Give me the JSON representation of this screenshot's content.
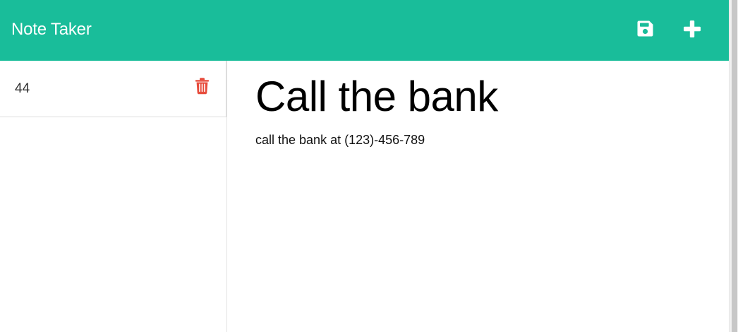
{
  "app": {
    "title": "Note Taker",
    "accent_color": "#19bd9a",
    "delete_color": "#e74c3c"
  },
  "toolbar": {
    "save_icon": "floppy-disk-icon",
    "new_note_icon": "plus-icon"
  },
  "sidebar": {
    "notes": [
      {
        "title": "44",
        "delete_icon": "trash-icon"
      }
    ]
  },
  "editor": {
    "title": "Call the bank",
    "body": "call the bank at (123)-456-789"
  }
}
